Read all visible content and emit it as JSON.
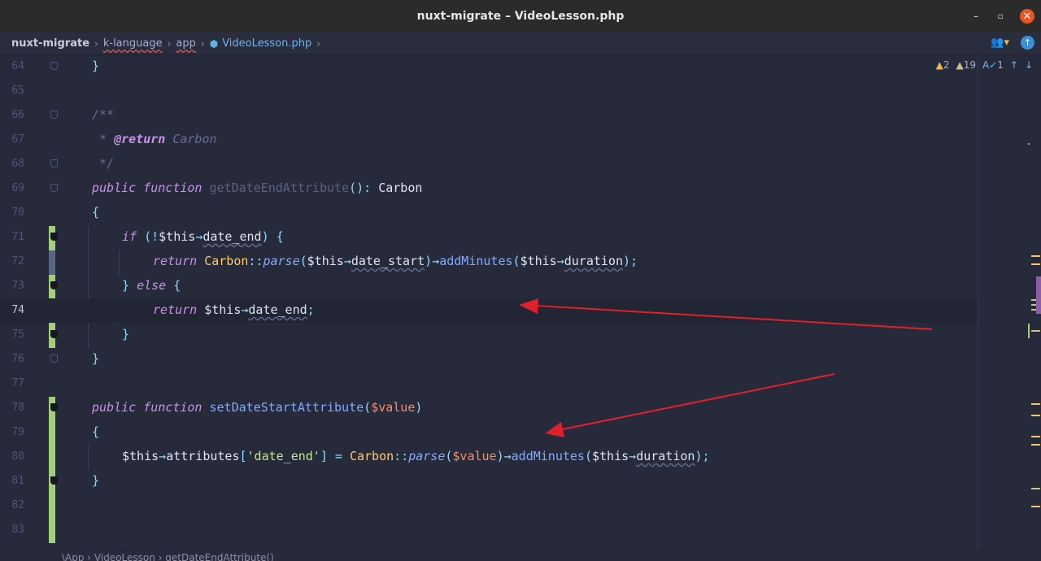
{
  "window": {
    "title": "nuxt-migrate – VideoLesson.php",
    "minimize": "–",
    "maximize": "▫",
    "close": "✕"
  },
  "breadcrumbs": [
    {
      "label": "nuxt-migrate"
    },
    {
      "label": "k-language"
    },
    {
      "label": "app"
    },
    {
      "label": "VideoLesson.php"
    }
  ],
  "breadcrumb_separator": "›",
  "inspection": {
    "warnings": "2",
    "weak_warnings": "19",
    "typos": "1",
    "warn_icon": "▲",
    "weak_icon": "▲",
    "typo_icon": "A✓",
    "up": "↑",
    "down": "↓"
  },
  "line_numbers": [
    "64",
    "65",
    "66",
    "67",
    "68",
    "69",
    "70",
    "71",
    "72",
    "73",
    "74",
    "75",
    "76",
    "77",
    "78",
    "79",
    "80",
    "81",
    "82",
    "83"
  ],
  "code": {
    "l64": "}",
    "l66": "/**",
    "l67_star": " * ",
    "l67_tag": "@return",
    "l67_type": " Carbon",
    "l68": " */",
    "kw_public": "public",
    "kw_function": "function",
    "fn_get": "getDateEndAttribute",
    "l69_sig": "(): ",
    "type_carbon": "Carbon",
    "brace_open": "{",
    "brace_close": "}",
    "kw_if": "if",
    "l71_cond_a": " (!",
    "this": "$this",
    "arrow": "→",
    "prop_date_end": "date_end",
    "l71_cond_b": ") {",
    "kw_return": "return",
    "class_carbon": "Carbon",
    "dcolon": "::",
    "fn_parse": "parse",
    "paren_open": "(",
    "prop_date_start": "date_start",
    "paren_close": ")",
    "fn_add": "addMinutes",
    "prop_duration": "duration",
    "end_stmt": ");",
    "semi": ";",
    "l73_a": "} ",
    "kw_else": "else",
    "l73_b": " {",
    "fn_set": "setDateStartAttribute",
    "var_value": "$value",
    "prop_attributes": "attributes",
    "bracket_open": "[",
    "str_date_end": "'date_end'",
    "bracket_close": "]",
    "assign": " = "
  },
  "status": {
    "path": "\\App  ›  VideoLesson  ›  getDateEndAttribute()"
  },
  "colors": {
    "arrow": "#e0202a",
    "gutter_change": "#a4cf7a"
  }
}
